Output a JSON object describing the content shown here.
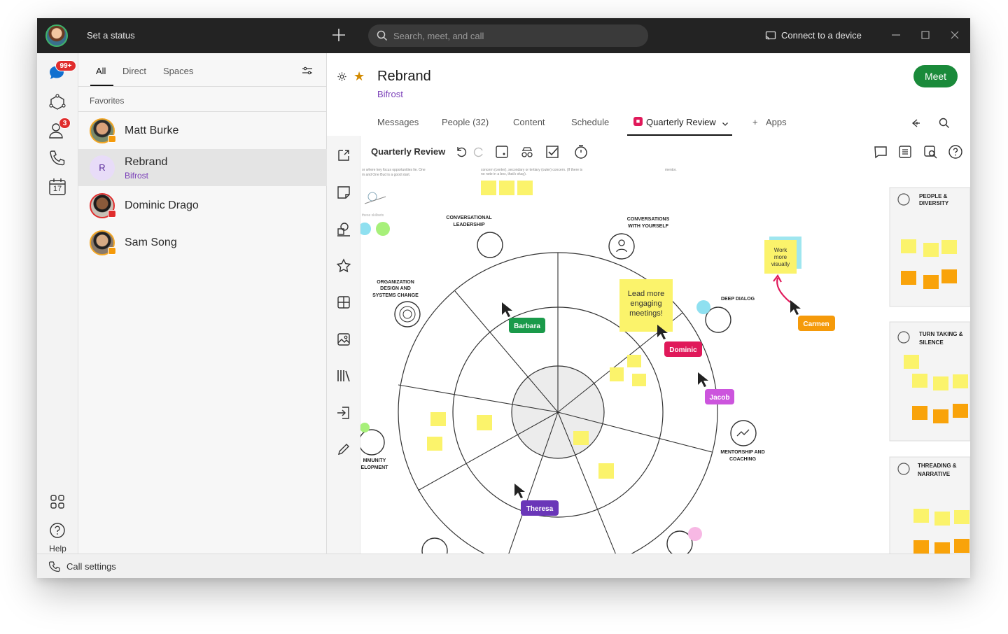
{
  "titlebar": {
    "status_label": "Set a status",
    "search_placeholder": "Search, meet, and call",
    "connect_label": "Connect to a device"
  },
  "rail": {
    "messages_badge": "99+",
    "contacts_badge": "3",
    "calendar_day": "17",
    "help_label": "Help"
  },
  "list": {
    "tabs": [
      "All",
      "Direct",
      "Spaces"
    ],
    "section": "Favorites",
    "items": [
      {
        "name": "Matt Burke",
        "sub": ""
      },
      {
        "name": "Rebrand",
        "sub": "Bifrost",
        "initial": "R"
      },
      {
        "name": "Dominic Drago",
        "sub": ""
      },
      {
        "name": "Sam Song",
        "sub": ""
      }
    ]
  },
  "space": {
    "title": "Rebrand",
    "subtitle": "Bifrost",
    "meet_label": "Meet",
    "tabs": [
      "Messages",
      "People (32)",
      "Content",
      "Schedule",
      "Quarterly Review",
      "Apps"
    ],
    "tab_apps_prefix": "+"
  },
  "whiteboard": {
    "name": "Quarterly Review",
    "labels": {
      "conv_leadership": [
        "CONVERSATIONAL",
        "LEADERSHIP"
      ],
      "conv_yourself": [
        "CONVERSATIONS",
        "WITH YOURSELF"
      ],
      "org_design": [
        "ORGANIZATION",
        "DESIGN AND",
        "SYSTEMS CHANGE"
      ],
      "deep_dialog": "DEEP DIALOG",
      "mentorship": [
        "MENTORSHIP AND",
        "COACHING"
      ],
      "community": [
        "MMUNITY",
        "ELOPMENT"
      ],
      "people_diversity": [
        "PEOPLE &",
        "DIVERSITY"
      ],
      "turn_taking": [
        "TURN TAKING &",
        "SILENCE"
      ],
      "threading": [
        "THREADING &",
        "NARRATIVE"
      ]
    },
    "sticky_lead": [
      "Lead more",
      "engaging",
      "meetings!"
    ],
    "sticky_work": [
      "Work",
      "more",
      "visually"
    ],
    "cursors": [
      "Barbara",
      "Dominic",
      "Jacob",
      "Carmen",
      "Theresa"
    ],
    "colors": {
      "barbara": "#1a9a4a",
      "dominic": "#e0195a",
      "jacob": "#cc55dd",
      "carmen": "#f59a0a",
      "theresa": "#6a36b8",
      "sticky_yellow": "#fbf36b",
      "sticky_orange": "#f9a30a"
    }
  },
  "bottom": {
    "call_settings": "Call settings"
  },
  "colors": {
    "accent_green": "#1a8a3a",
    "space_purple": "#7a3fb8",
    "badge_red": "#e02d2d",
    "titlebar": "#232323"
  }
}
